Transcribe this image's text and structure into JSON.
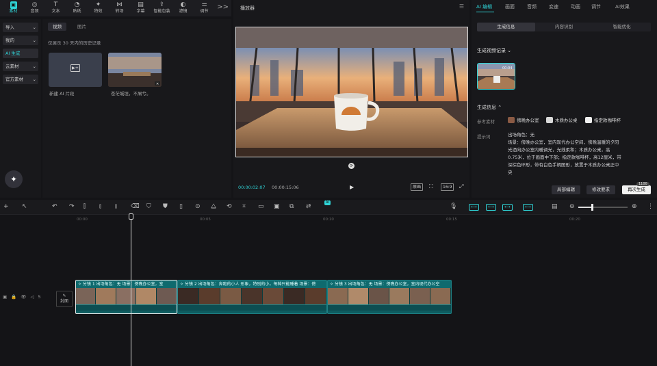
{
  "toolbar": {
    "tools": [
      {
        "label": "素材",
        "icon": "media-icon",
        "glyph": "▣",
        "active": true
      },
      {
        "label": "音频",
        "icon": "audio-icon",
        "glyph": "◎",
        "active": false
      },
      {
        "label": "文本",
        "icon": "text-icon",
        "glyph": "T",
        "active": false
      },
      {
        "label": "贴纸",
        "icon": "sticker-icon",
        "glyph": "◔",
        "active": false
      },
      {
        "label": "特效",
        "icon": "effects-icon",
        "glyph": "✦",
        "active": false
      },
      {
        "label": "转场",
        "icon": "transition-icon",
        "glyph": "⋈",
        "active": false
      },
      {
        "label": "字幕",
        "icon": "caption-icon",
        "glyph": "▤",
        "active": false
      },
      {
        "label": "智能包装",
        "icon": "smart-pack-icon",
        "glyph": "⇪",
        "active": false
      },
      {
        "label": "滤镜",
        "icon": "filter-icon",
        "glyph": "◐",
        "active": false
      },
      {
        "label": "调节",
        "icon": "adjust-icon",
        "glyph": "⚌",
        "active": false
      }
    ],
    "more": ">>"
  },
  "sidebar": {
    "items": [
      {
        "label": "导入",
        "arrow": "⌄",
        "active": false
      },
      {
        "label": "我的",
        "arrow": "⌄",
        "active": false
      },
      {
        "label": "AI 生成",
        "arrow": "",
        "active": true
      },
      {
        "label": "云素材",
        "arrow": "⌄",
        "active": false
      },
      {
        "label": "官方素材",
        "arrow": "⌄",
        "active": false
      }
    ]
  },
  "media": {
    "tabs": [
      "视频",
      "图片"
    ],
    "history_note": "仅展示 30 天内的历史记录",
    "new_clip_label": "新建 AI 片段",
    "generated_label": "苍茫城垣，不屑兮。"
  },
  "player": {
    "title": "播放器",
    "timecode": "00:00:02:07",
    "duration": "00:00:15:06",
    "buttons": [
      "原画",
      "⛶",
      "16:9",
      "⤢"
    ]
  },
  "right_panel": {
    "tabs": [
      "AI 编辑",
      "画面",
      "音频",
      "变速",
      "动画",
      "调节",
      "AI效果"
    ],
    "segments": [
      "生成信息",
      "内容识别",
      "智能优化"
    ],
    "video_record_title": "生成视频记录 ⌄",
    "gen_info_title": "生成信息 ⌃",
    "reference_label": "参考素材",
    "chips": [
      {
        "label": "傍晚办公室",
        "color": "#8a5a44"
      },
      {
        "label": "木质办公桌",
        "color": "#d9d9d9"
      },
      {
        "label": "指定款咖啡杯",
        "color": "#f0f0f0"
      }
    ],
    "prompt_label": "提示词",
    "prompt_lines": [
      "出场角色：无",
      "场景：傍晚办公室，室内现代办公空间，傍晚温暖的夕阳",
      "光洒向办公室内暖调光，光线柔和；木质办公桌，高",
      "0.75米，位于画面中下部；指定款咖啡杯，高12厘米，带",
      "深棕色环形，带有白色手柄图形，放置于木质办公桌正中",
      "央"
    ],
    "buttons": [
      "局部编辑",
      "修改要求",
      "再次生成"
    ],
    "cost": "1100"
  },
  "timeline": {
    "ai_badge": "AI",
    "ruler": [
      "00:00",
      "00:05",
      "00:10",
      "00:15",
      "00:20"
    ],
    "track_controls": [
      "▣",
      "🔒",
      "👁",
      "◁",
      "5"
    ],
    "cover_label": "封面",
    "clips": [
      {
        "label": "✧ 分镜 1 出场角色：无 场景：傍晚办公室，室",
        "selected": true
      },
      {
        "label": "✧ 分镜 2 出场角色：奔跑的小人 形象，特别的小，每种只能睡着 场景：傍",
        "selected": false
      },
      {
        "label": "✧ 分镜 3 出场角色：无 场景：傍晚办公室，室内现代办公空",
        "selected": false
      }
    ]
  }
}
